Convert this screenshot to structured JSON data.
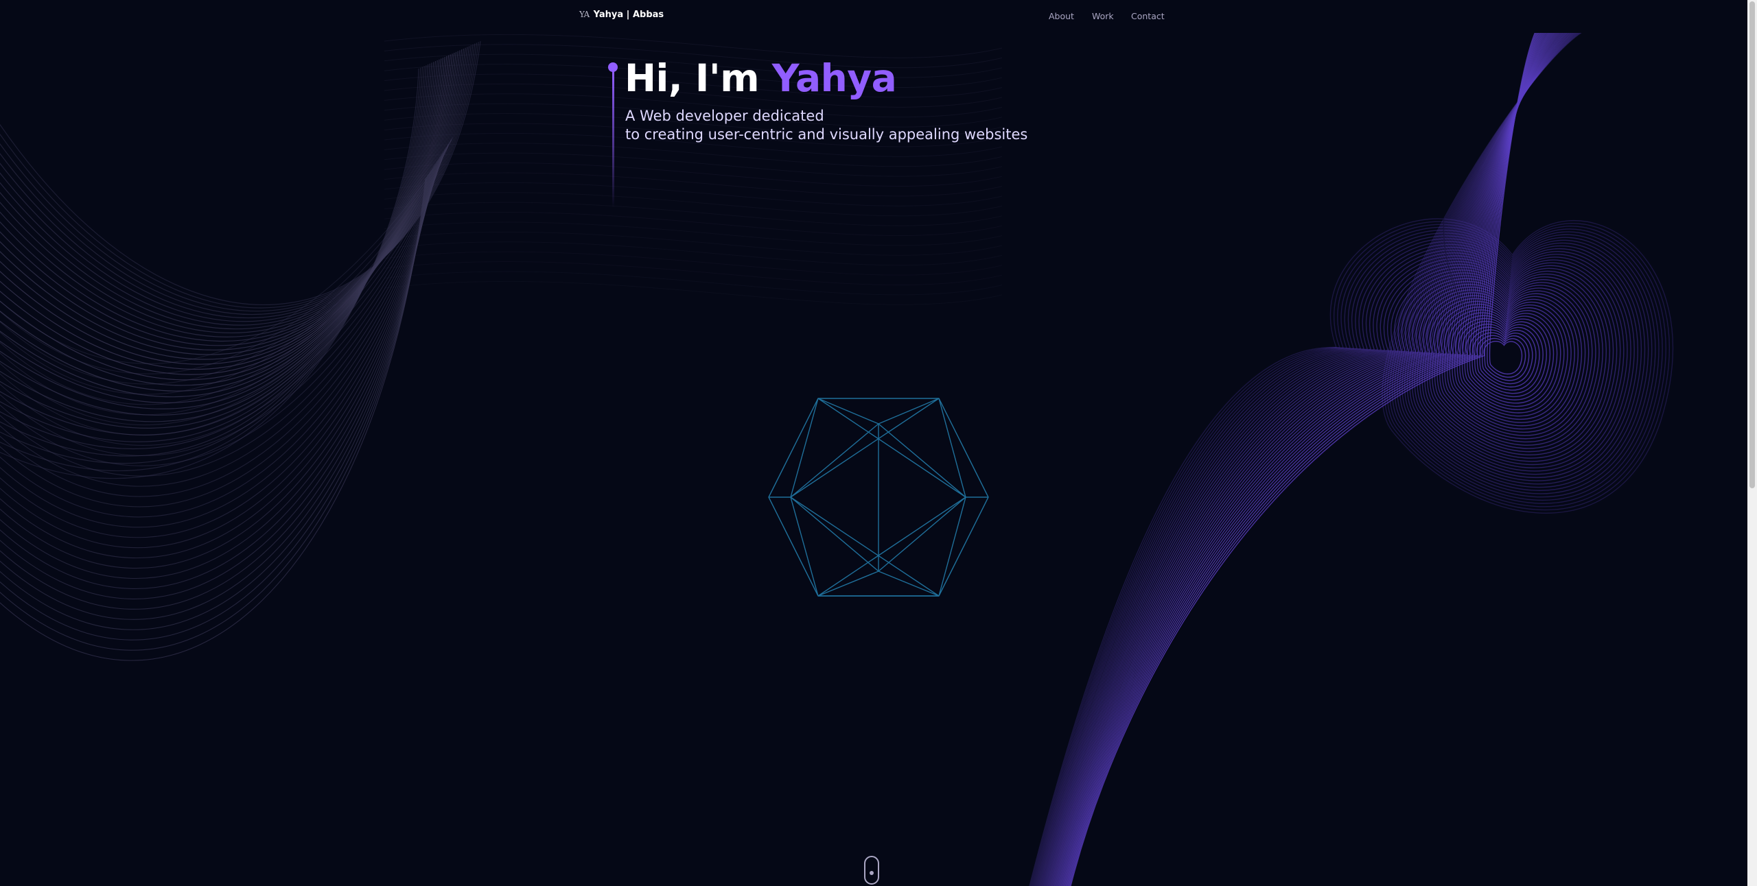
{
  "header": {
    "logo_text": "YA",
    "brand_name": "Yahya | Abbas",
    "nav": {
      "about": "About",
      "work": "Work",
      "contact": "Contact"
    }
  },
  "hero": {
    "greeting": "Hi, I'm",
    "name": "Yahya",
    "subtitle_line1": "A Web developer dedicated",
    "subtitle_line2": "to creating user-centric and visually appealing websites"
  },
  "colors": {
    "background": "#050816",
    "accent": "#915eff",
    "wave_left": "#3a3856",
    "wave_right": "#5b3fc4",
    "icosahedron": "#1f6f9a",
    "text_secondary": "#aaa6c3"
  },
  "icons": {
    "scroll_indicator": "mouse-scroll-icon",
    "hero_dot": "timeline-dot-icon"
  }
}
